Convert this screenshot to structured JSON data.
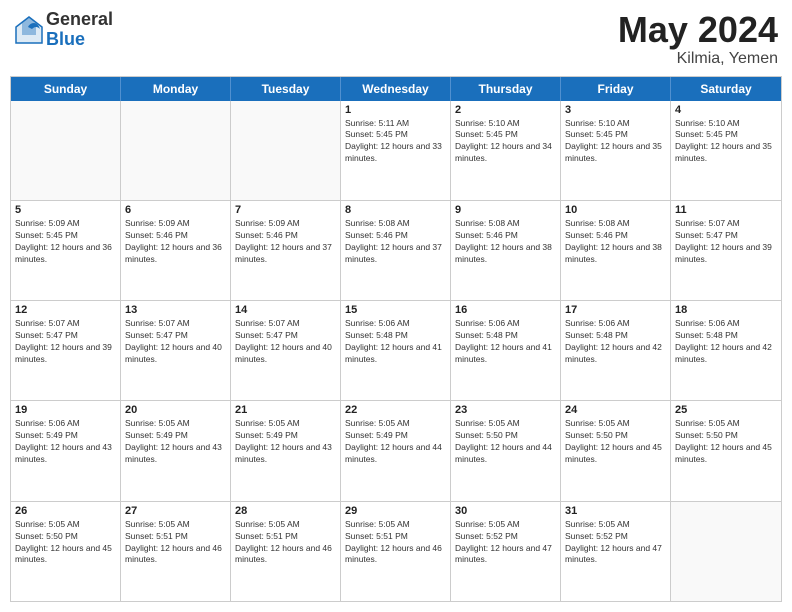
{
  "logo": {
    "general": "General",
    "blue": "Blue"
  },
  "title": {
    "month_year": "May 2024",
    "location": "Kilmia, Yemen"
  },
  "weekdays": [
    "Sunday",
    "Monday",
    "Tuesday",
    "Wednesday",
    "Thursday",
    "Friday",
    "Saturday"
  ],
  "weeks": [
    [
      {
        "day": "",
        "sunrise": "",
        "sunset": "",
        "daylight": "",
        "empty": true
      },
      {
        "day": "",
        "sunrise": "",
        "sunset": "",
        "daylight": "",
        "empty": true
      },
      {
        "day": "",
        "sunrise": "",
        "sunset": "",
        "daylight": "",
        "empty": true
      },
      {
        "day": "1",
        "sunrise": "Sunrise: 5:11 AM",
        "sunset": "Sunset: 5:45 PM",
        "daylight": "Daylight: 12 hours and 33 minutes."
      },
      {
        "day": "2",
        "sunrise": "Sunrise: 5:10 AM",
        "sunset": "Sunset: 5:45 PM",
        "daylight": "Daylight: 12 hours and 34 minutes."
      },
      {
        "day": "3",
        "sunrise": "Sunrise: 5:10 AM",
        "sunset": "Sunset: 5:45 PM",
        "daylight": "Daylight: 12 hours and 35 minutes."
      },
      {
        "day": "4",
        "sunrise": "Sunrise: 5:10 AM",
        "sunset": "Sunset: 5:45 PM",
        "daylight": "Daylight: 12 hours and 35 minutes."
      }
    ],
    [
      {
        "day": "5",
        "sunrise": "Sunrise: 5:09 AM",
        "sunset": "Sunset: 5:45 PM",
        "daylight": "Daylight: 12 hours and 36 minutes."
      },
      {
        "day": "6",
        "sunrise": "Sunrise: 5:09 AM",
        "sunset": "Sunset: 5:46 PM",
        "daylight": "Daylight: 12 hours and 36 minutes."
      },
      {
        "day": "7",
        "sunrise": "Sunrise: 5:09 AM",
        "sunset": "Sunset: 5:46 PM",
        "daylight": "Daylight: 12 hours and 37 minutes."
      },
      {
        "day": "8",
        "sunrise": "Sunrise: 5:08 AM",
        "sunset": "Sunset: 5:46 PM",
        "daylight": "Daylight: 12 hours and 37 minutes."
      },
      {
        "day": "9",
        "sunrise": "Sunrise: 5:08 AM",
        "sunset": "Sunset: 5:46 PM",
        "daylight": "Daylight: 12 hours and 38 minutes."
      },
      {
        "day": "10",
        "sunrise": "Sunrise: 5:08 AM",
        "sunset": "Sunset: 5:46 PM",
        "daylight": "Daylight: 12 hours and 38 minutes."
      },
      {
        "day": "11",
        "sunrise": "Sunrise: 5:07 AM",
        "sunset": "Sunset: 5:47 PM",
        "daylight": "Daylight: 12 hours and 39 minutes."
      }
    ],
    [
      {
        "day": "12",
        "sunrise": "Sunrise: 5:07 AM",
        "sunset": "Sunset: 5:47 PM",
        "daylight": "Daylight: 12 hours and 39 minutes."
      },
      {
        "day": "13",
        "sunrise": "Sunrise: 5:07 AM",
        "sunset": "Sunset: 5:47 PM",
        "daylight": "Daylight: 12 hours and 40 minutes."
      },
      {
        "day": "14",
        "sunrise": "Sunrise: 5:07 AM",
        "sunset": "Sunset: 5:47 PM",
        "daylight": "Daylight: 12 hours and 40 minutes."
      },
      {
        "day": "15",
        "sunrise": "Sunrise: 5:06 AM",
        "sunset": "Sunset: 5:48 PM",
        "daylight": "Daylight: 12 hours and 41 minutes."
      },
      {
        "day": "16",
        "sunrise": "Sunrise: 5:06 AM",
        "sunset": "Sunset: 5:48 PM",
        "daylight": "Daylight: 12 hours and 41 minutes."
      },
      {
        "day": "17",
        "sunrise": "Sunrise: 5:06 AM",
        "sunset": "Sunset: 5:48 PM",
        "daylight": "Daylight: 12 hours and 42 minutes."
      },
      {
        "day": "18",
        "sunrise": "Sunrise: 5:06 AM",
        "sunset": "Sunset: 5:48 PM",
        "daylight": "Daylight: 12 hours and 42 minutes."
      }
    ],
    [
      {
        "day": "19",
        "sunrise": "Sunrise: 5:06 AM",
        "sunset": "Sunset: 5:49 PM",
        "daylight": "Daylight: 12 hours and 43 minutes."
      },
      {
        "day": "20",
        "sunrise": "Sunrise: 5:05 AM",
        "sunset": "Sunset: 5:49 PM",
        "daylight": "Daylight: 12 hours and 43 minutes."
      },
      {
        "day": "21",
        "sunrise": "Sunrise: 5:05 AM",
        "sunset": "Sunset: 5:49 PM",
        "daylight": "Daylight: 12 hours and 43 minutes."
      },
      {
        "day": "22",
        "sunrise": "Sunrise: 5:05 AM",
        "sunset": "Sunset: 5:49 PM",
        "daylight": "Daylight: 12 hours and 44 minutes."
      },
      {
        "day": "23",
        "sunrise": "Sunrise: 5:05 AM",
        "sunset": "Sunset: 5:50 PM",
        "daylight": "Daylight: 12 hours and 44 minutes."
      },
      {
        "day": "24",
        "sunrise": "Sunrise: 5:05 AM",
        "sunset": "Sunset: 5:50 PM",
        "daylight": "Daylight: 12 hours and 45 minutes."
      },
      {
        "day": "25",
        "sunrise": "Sunrise: 5:05 AM",
        "sunset": "Sunset: 5:50 PM",
        "daylight": "Daylight: 12 hours and 45 minutes."
      }
    ],
    [
      {
        "day": "26",
        "sunrise": "Sunrise: 5:05 AM",
        "sunset": "Sunset: 5:50 PM",
        "daylight": "Daylight: 12 hours and 45 minutes."
      },
      {
        "day": "27",
        "sunrise": "Sunrise: 5:05 AM",
        "sunset": "Sunset: 5:51 PM",
        "daylight": "Daylight: 12 hours and 46 minutes."
      },
      {
        "day": "28",
        "sunrise": "Sunrise: 5:05 AM",
        "sunset": "Sunset: 5:51 PM",
        "daylight": "Daylight: 12 hours and 46 minutes."
      },
      {
        "day": "29",
        "sunrise": "Sunrise: 5:05 AM",
        "sunset": "Sunset: 5:51 PM",
        "daylight": "Daylight: 12 hours and 46 minutes."
      },
      {
        "day": "30",
        "sunrise": "Sunrise: 5:05 AM",
        "sunset": "Sunset: 5:52 PM",
        "daylight": "Daylight: 12 hours and 47 minutes."
      },
      {
        "day": "31",
        "sunrise": "Sunrise: 5:05 AM",
        "sunset": "Sunset: 5:52 PM",
        "daylight": "Daylight: 12 hours and 47 minutes."
      },
      {
        "day": "",
        "sunrise": "",
        "sunset": "",
        "daylight": "",
        "empty": true
      }
    ]
  ]
}
